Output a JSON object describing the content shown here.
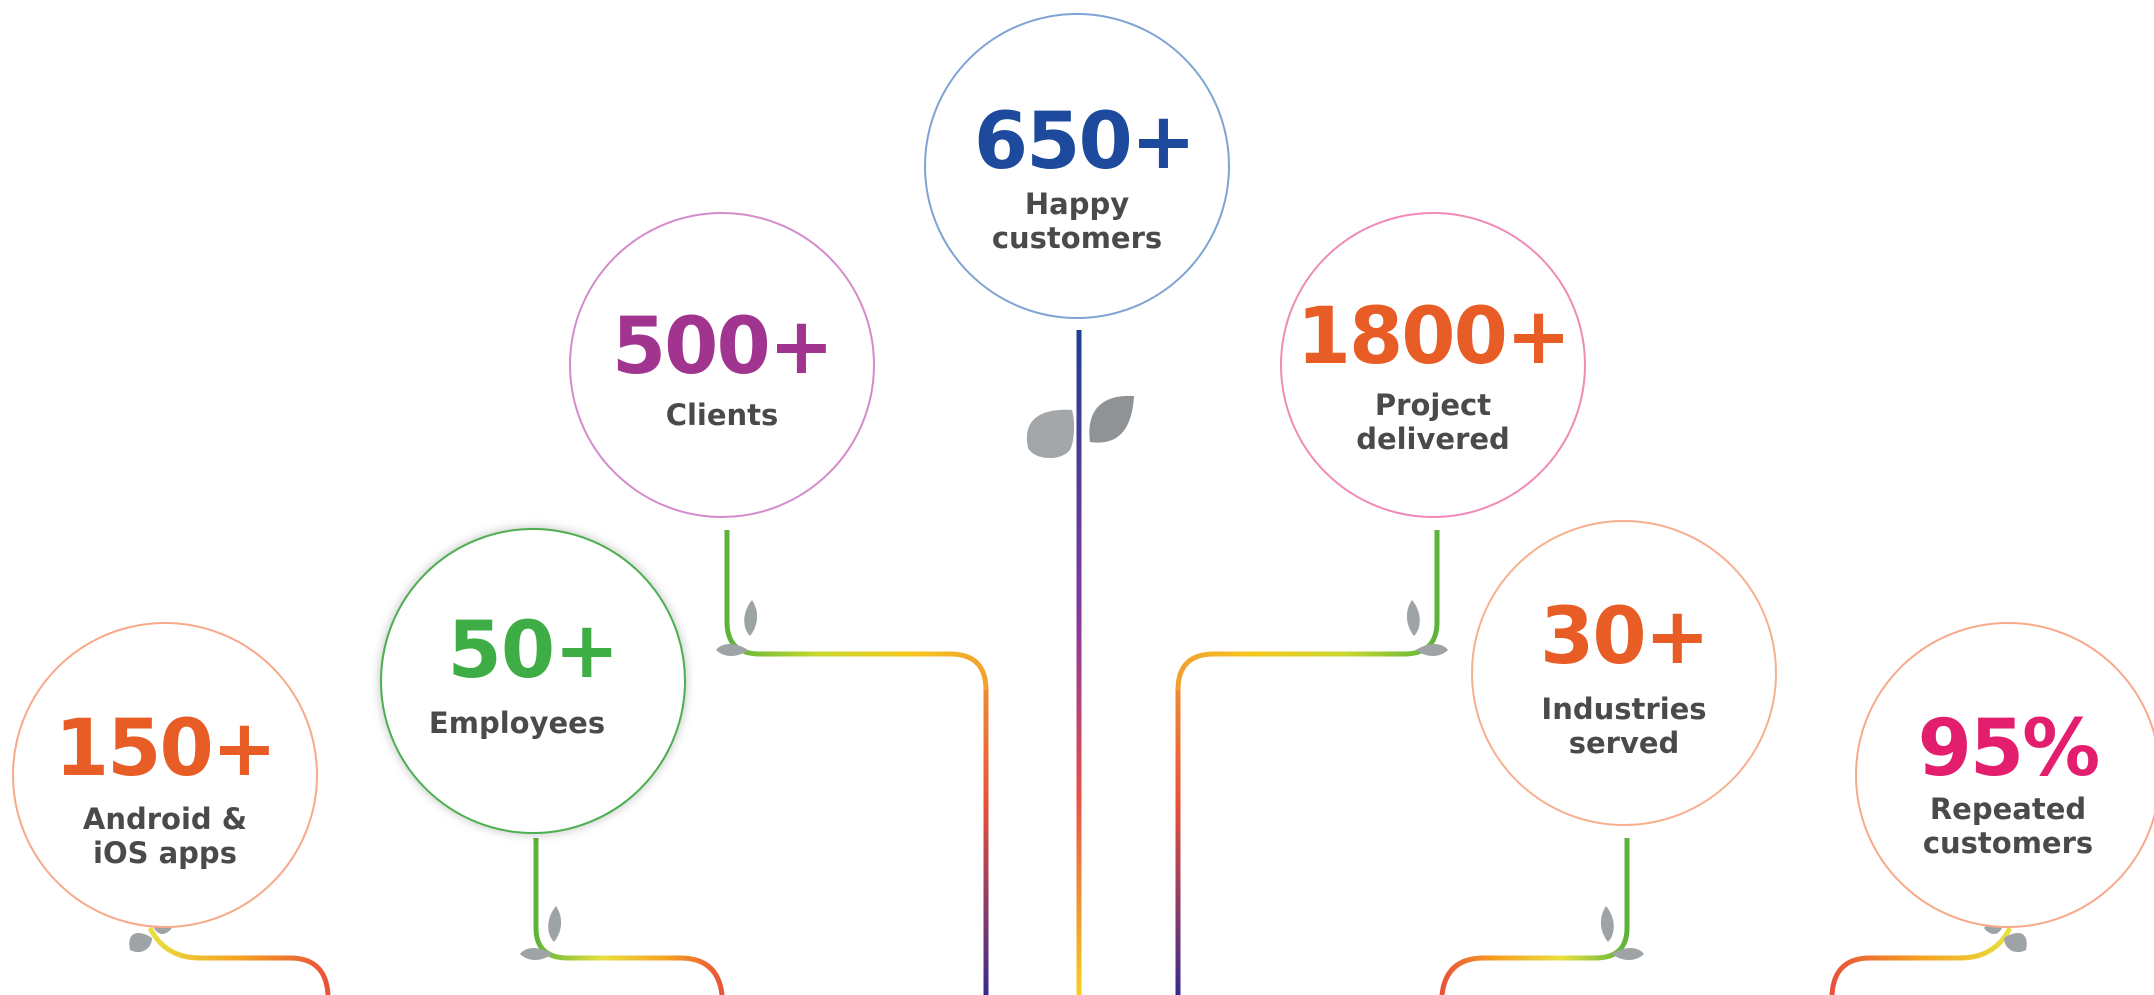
{
  "colors": {
    "orange": "#e85d26",
    "green": "#3fad46",
    "purple": "#a1348e",
    "navy": "#1d4a9c",
    "pink": "#e31e6f",
    "leaf": "#9ea3a6",
    "label_text": "#4a4a4a"
  },
  "icons": [
    "leaf-icon"
  ],
  "stats": {
    "apps": {
      "value": "150+",
      "label": "Android &\niOS apps"
    },
    "employees": {
      "value": "50+",
      "label": "Employees"
    },
    "clients": {
      "value": "500+",
      "label": "Clients"
    },
    "customers": {
      "value": "650+",
      "label": "Happy\ncustomers"
    },
    "projects": {
      "value": "1800+",
      "label": "Project\ndelivered"
    },
    "industries": {
      "value": "30+",
      "label": "Industries\nserved"
    },
    "repeat": {
      "value": "95%",
      "label": "Repeated\ncustomers"
    }
  }
}
